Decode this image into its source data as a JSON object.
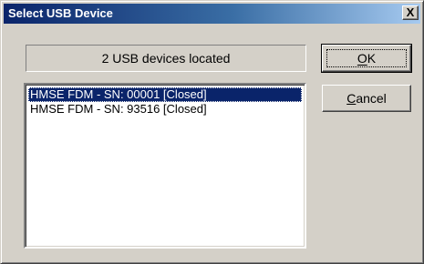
{
  "window": {
    "title": "Select USB Device",
    "close_glyph": "X"
  },
  "status": {
    "text": "2 USB devices located"
  },
  "buttons": {
    "ok_label": "OK",
    "cancel_label": "Cancel"
  },
  "devices": {
    "items": [
      {
        "label": "HMSE FDM - SN: 00001  [Closed]",
        "selected": true
      },
      {
        "label": "HMSE FDM - SN: 93516  [Closed]",
        "selected": false
      }
    ]
  },
  "colors": {
    "title_bar": "#0a246a",
    "selection": "#0a246a",
    "dialog_face": "#d4d0c8"
  }
}
